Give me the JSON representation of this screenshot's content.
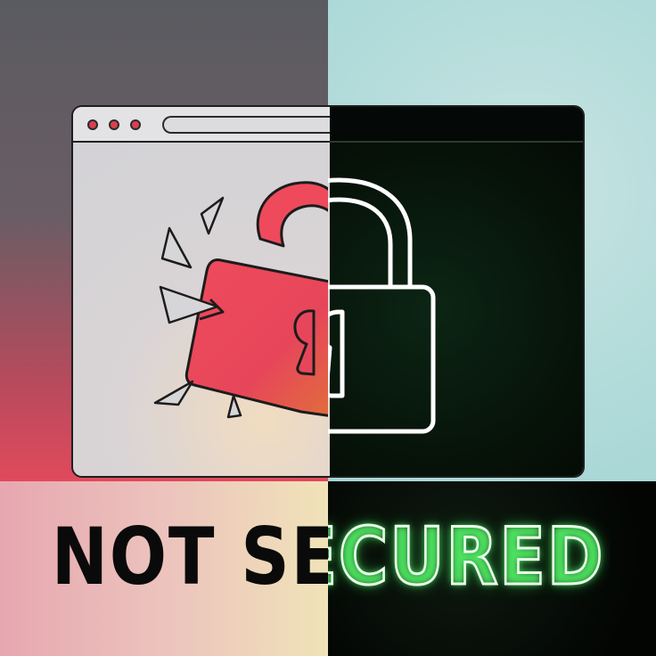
{
  "caption": {
    "text": "NOT SECURED"
  },
  "icons": {
    "broken_lock": "broken-open-padlock-icon",
    "secure_lock": "closed-padlock-icon",
    "window_controls": "window-control-dots"
  },
  "colors": {
    "accent_red": "#e8404f",
    "neon_green": "#5aff6e",
    "dark_panel": "#07140a"
  }
}
